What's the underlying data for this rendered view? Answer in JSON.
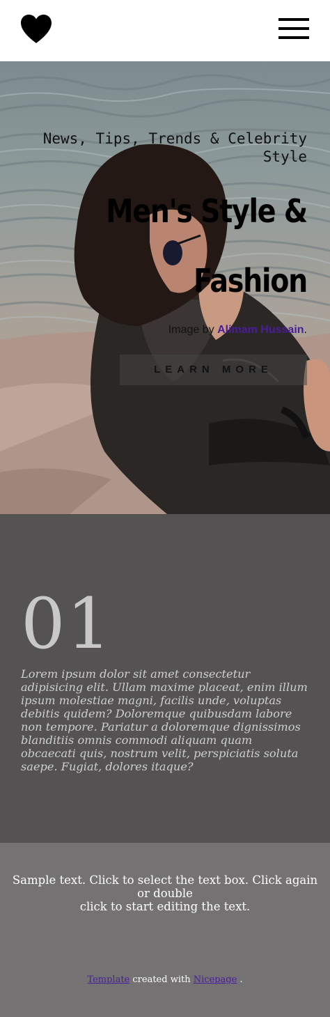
{
  "header": {
    "logo_icon": "heart-icon",
    "menu_icon": "hamburger-menu-icon"
  },
  "hero": {
    "subtitle": "News, Tips, Trends & Celebrity Style",
    "title_line1": "Men's Style &",
    "title_line2": "Fashion",
    "credit_prefix": "Image by ",
    "credit_author": "Alimam Hussain",
    "credit_suffix": ".",
    "button_label": "LEARN MORE"
  },
  "feature": {
    "number": "01",
    "text": "Lorem ipsum dolor sit amet consectetur adipisicing elit. Ullam maxime placeat, enim illum ipsum molestiae magni, facilis unde, voluptas debitis quidem? Doloremque quibusdam labore non tempore. Pariatur a doloremque dignissimos blanditiis omnis commodi aliquam quam obcaecati quis, nostrum velit, perspiciatis soluta saepe. Fugiat, dolores itaque?"
  },
  "footer": {
    "sample_line1": "Sample text. Click to select the text box. Click again or double",
    "sample_line2": "click to start editing the text.",
    "credit_link1": "Template",
    "credit_middle": " created with ",
    "credit_link2": "Nicepage",
    "credit_end": " ."
  },
  "colors": {
    "link": "#4a1d9b",
    "dark_section": "#545253",
    "grey_section": "#747273"
  }
}
